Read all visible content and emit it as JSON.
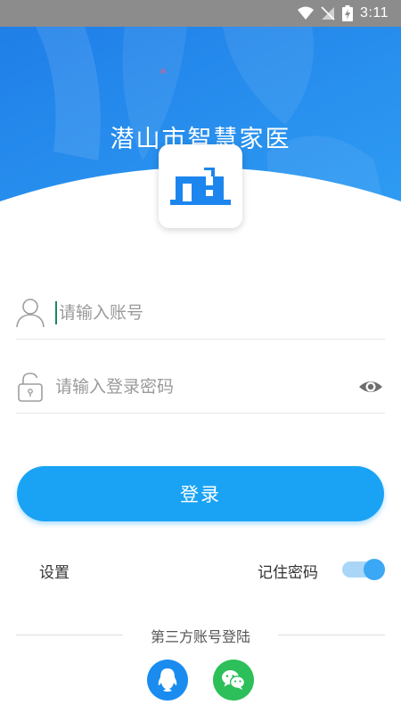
{
  "status_bar": {
    "time": "3:11"
  },
  "header": {
    "app_title": "潜山市智慧家医"
  },
  "login_form": {
    "account_placeholder": "请输入账号",
    "password_placeholder": "请输入登录密码",
    "login_label": "登录"
  },
  "options": {
    "settings_label": "设置",
    "remember_label": "记住密码",
    "remember_enabled": true
  },
  "third_party": {
    "label": "第三方账号登陆",
    "providers": [
      "qq-icon",
      "wechat-icon"
    ]
  },
  "colors": {
    "primary": "#1aa3f5",
    "header_blue": "#1d86ee",
    "qq": "#1a8cf0",
    "wechat": "#2cbf5a"
  }
}
